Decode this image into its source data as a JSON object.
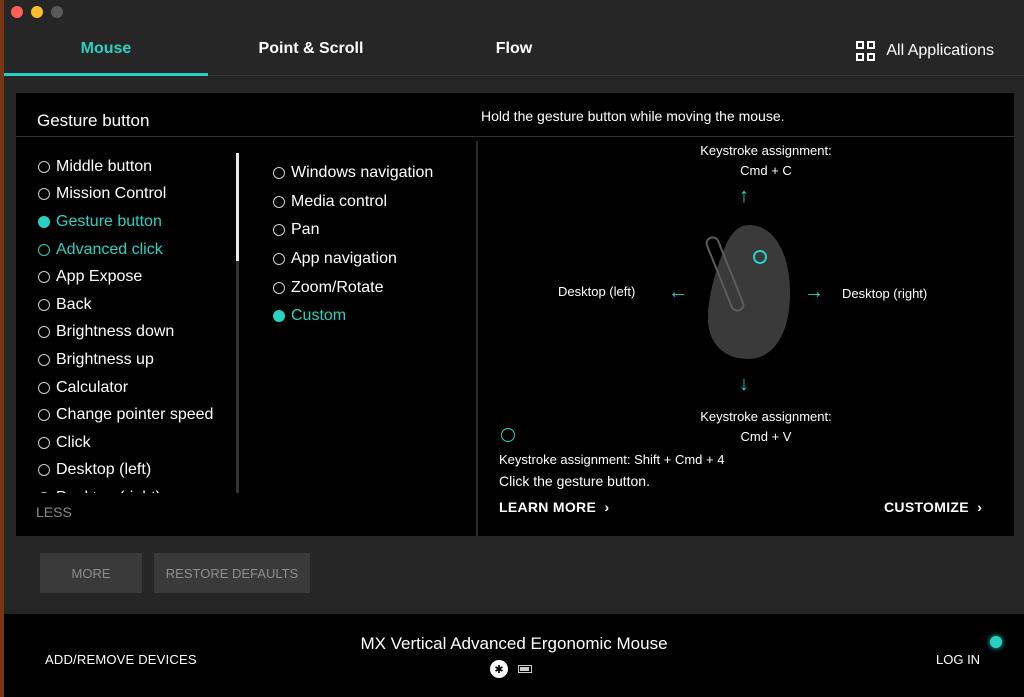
{
  "tabs": [
    {
      "label": "Mouse",
      "active": true
    },
    {
      "label": "Point & Scroll",
      "active": false
    },
    {
      "label": "Flow",
      "active": false
    }
  ],
  "all_applications": "All Applications",
  "panel": {
    "title": "Gesture button",
    "hint": "Hold the gesture button while moving the mouse."
  },
  "actions_list": [
    {
      "label": "Middle button",
      "state": "normal"
    },
    {
      "label": "Mission Control",
      "state": "normal"
    },
    {
      "label": "Gesture button",
      "state": "selected"
    },
    {
      "label": "Advanced click",
      "state": "highlight"
    },
    {
      "label": "App Expose",
      "state": "normal"
    },
    {
      "label": "Back",
      "state": "normal"
    },
    {
      "label": "Brightness down",
      "state": "normal"
    },
    {
      "label": "Brightness up",
      "state": "normal"
    },
    {
      "label": "Calculator",
      "state": "normal"
    },
    {
      "label": "Change pointer speed",
      "state": "normal"
    },
    {
      "label": "Click",
      "state": "normal"
    },
    {
      "label": "Desktop (left)",
      "state": "normal"
    },
    {
      "label": "Desktop (right)",
      "state": "normal"
    }
  ],
  "gesture_modes": [
    {
      "label": "Windows navigation",
      "state": "normal"
    },
    {
      "label": "Media control",
      "state": "normal"
    },
    {
      "label": "Pan",
      "state": "normal"
    },
    {
      "label": "App navigation",
      "state": "normal"
    },
    {
      "label": "Zoom/Rotate",
      "state": "normal"
    },
    {
      "label": "Custom",
      "state": "selected"
    }
  ],
  "less_label": "LESS",
  "gesture_visual": {
    "up_title": "Keystroke assignment:",
    "up_value": "Cmd + C",
    "down_title": "Keystroke assignment:",
    "down_value": "Cmd + V",
    "left_label": "Desktop (left)",
    "right_label": "Desktop (right)"
  },
  "click_info": {
    "assignment": "Keystroke assignment: Shift + Cmd + 4",
    "instruction": "Click the gesture button."
  },
  "learn_more": "LEARN MORE",
  "customize": "CUSTOMIZE",
  "buttons": {
    "more": "MORE",
    "restore": "RESTORE DEFAULTS"
  },
  "footer": {
    "add_remove": "ADD/REMOVE DEVICES",
    "device_name": "MX Vertical Advanced Ergonomic Mouse",
    "login": "LOG IN"
  },
  "colors": {
    "accent": "#28d2c2",
    "background": "#262626",
    "panel": "#000000"
  }
}
